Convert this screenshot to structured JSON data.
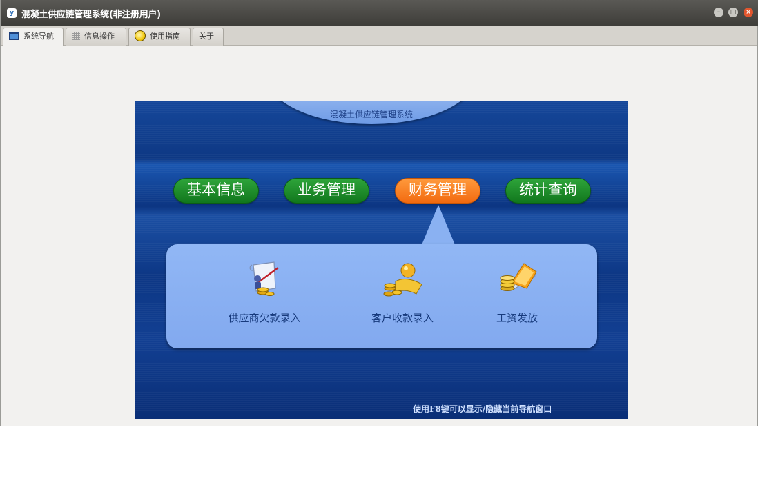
{
  "window": {
    "title": "混凝土供应链管理系统(非注册用户)",
    "logo_text": "y",
    "controls": {
      "minimize": "–",
      "maximize": "□",
      "close": "×"
    }
  },
  "tabs": [
    {
      "label": "系统导航",
      "icon": "monitor-icon",
      "active": true
    },
    {
      "label": "信息操作",
      "icon": "grid-icon",
      "active": false
    },
    {
      "label": "使用指南",
      "icon": "guide-icon",
      "active": false
    },
    {
      "label": "关于",
      "icon": "",
      "active": false
    }
  ],
  "nav_panel": {
    "title": "混凝土供应链管理系统",
    "menu": [
      {
        "label": "基本信息",
        "selected": false
      },
      {
        "label": "业务管理",
        "selected": false
      },
      {
        "label": "财务管理",
        "selected": true
      },
      {
        "label": "统计查询",
        "selected": false
      }
    ],
    "submenu": [
      {
        "label": "供应商欠款录入",
        "icon": "supplier-debt-icon"
      },
      {
        "label": "客户收款录入",
        "icon": "customer-receipt-icon"
      },
      {
        "label": "工资发放",
        "icon": "payroll-icon"
      }
    ],
    "hint": "使用F8键可以显示/隐藏当前导航窗口"
  },
  "colors": {
    "panel_blue": "#0e3884",
    "menu_green": "#1b8a26",
    "menu_orange": "#f5761c",
    "submenu_bg": "#8ab1f2"
  }
}
